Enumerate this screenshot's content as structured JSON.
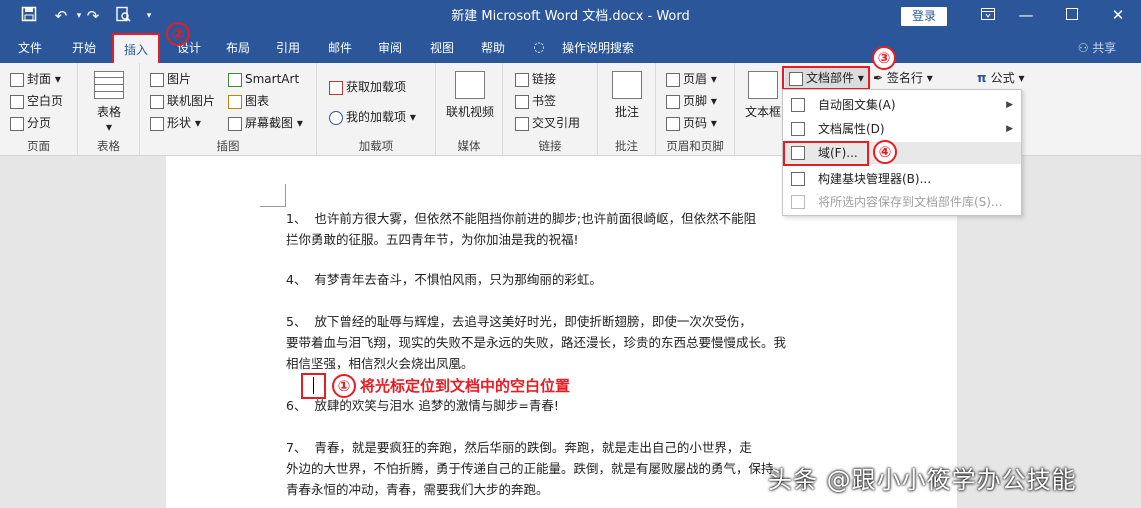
{
  "qat": {
    "save_icon": "save-icon",
    "undo_icon": "undo-icon",
    "redo_icon": "redo-icon",
    "preview_icon": "print-preview-icon",
    "customize_icon": "customize-icon"
  },
  "title": "新建 Microsoft Word 文档.docx  -  Word",
  "login": "登录",
  "tabs": [
    "文件",
    "开始",
    "插入",
    "设计",
    "布局",
    "引用",
    "邮件",
    "审阅",
    "视图",
    "帮助",
    "操作说明搜索",
    "共享"
  ],
  "groups": {
    "pages": {
      "label": "页面",
      "items": [
        "封面",
        "空白页",
        "分页"
      ]
    },
    "tables": {
      "label": "表格",
      "item": "表格"
    },
    "illustrations": {
      "label": "插图",
      "items": [
        "图片",
        "联机图片",
        "形状",
        "SmartArt",
        "图表",
        "屏幕截图"
      ]
    },
    "addins": {
      "label": "加载项",
      "items": [
        "获取加载项",
        "我的加载项"
      ]
    },
    "media": {
      "label": "媒体",
      "item": "联机视频"
    },
    "links": {
      "label": "链接",
      "items": [
        "链接",
        "书签",
        "交叉引用"
      ]
    },
    "comments": {
      "label": "批注",
      "item": "批注"
    },
    "header_footer": {
      "label": "页眉和页脚",
      "items": [
        "页眉",
        "页脚",
        "页码"
      ]
    },
    "text": {
      "item": "文本框",
      "parts": "文档部件",
      "signature": "签名行"
    },
    "symbols": {
      "formula": "公式"
    }
  },
  "menu": [
    {
      "label": "自动图文集(A)",
      "sub": true
    },
    {
      "label": "文档属性(D)",
      "sub": true
    },
    {
      "label": "域(F)...",
      "sub": false
    },
    {
      "label": "构建基块管理器(B)...",
      "sub": false
    },
    {
      "label": "将所选内容保存到文档部件库(S)...",
      "sub": false,
      "disabled": true
    }
  ],
  "callouts": [
    "①",
    "②",
    "③",
    "④"
  ],
  "instruction": "将光标定位到文档中的空白位置",
  "paragraphs": [
    "1、  也许前方很大雾，但依然不能阻挡你前进的脚步;也许前面很崎岖，但依然不能阻",
    "拦你勇敢的征服。五四青年节，为你加油是我的祝福!",
    "4、  有梦青年去奋斗，不惧怕风雨，只为那绚丽的彩虹。",
    "5、  放下曾经的耻辱与辉煌，去追寻这美好时光，即使折断翅膀，即使一次次受伤，",
    "要带着血与泪飞翔，现实的失败不是永远的失败，路还漫长，珍贵的东西总要慢慢成长。我",
    "相信坚强，相信烈火会烧出凤凰。",
    "6、  放肆的欢笑与泪水 追梦的激情与脚步=青春!",
    "7、  青春，就是要疯狂的奔跑，然后华丽的跌倒。奔跑，就是走出自己的小世界，走",
    "外边的大世界，不怕折腾，勇于传递自己的正能量。跌倒，就是有屡败屡战的勇气，保持",
    "青春永恒的冲动，青春，需要我们大步的奔跑。"
  ],
  "watermark": "头条 @跟小小筱学办公技能",
  "colors": {
    "accent": "#2b579a",
    "highlight": "#e81c24"
  }
}
